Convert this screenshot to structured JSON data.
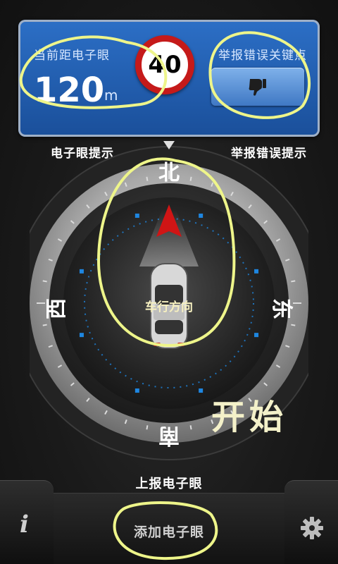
{
  "top_panel": {
    "distance_label": "当前距电子眼",
    "distance_value": "120",
    "distance_unit": "m",
    "speed_limit": "40",
    "report_label": "举报错误关键点",
    "report_icon": "thumbs-down-icon"
  },
  "compass": {
    "left_label": "电子眼提示",
    "right_label": "举报错误提示",
    "north": "北",
    "east": "东",
    "south": "南",
    "west": "西",
    "center_label": "车行方向"
  },
  "start_text": "开始",
  "report_eye_label": "上报电子眼",
  "bottom_bar": {
    "info_icon": "info-icon",
    "info_glyph": "i",
    "add_eye_label": "添加电子眼",
    "settings_icon": "gear-icon"
  },
  "colors": {
    "panel_blue": "#2c6fc6",
    "speed_red": "#c51a1a",
    "arrow_red": "#d01515",
    "annotation_yellow": "#eef58a",
    "tick_blue": "#1e86e0"
  }
}
